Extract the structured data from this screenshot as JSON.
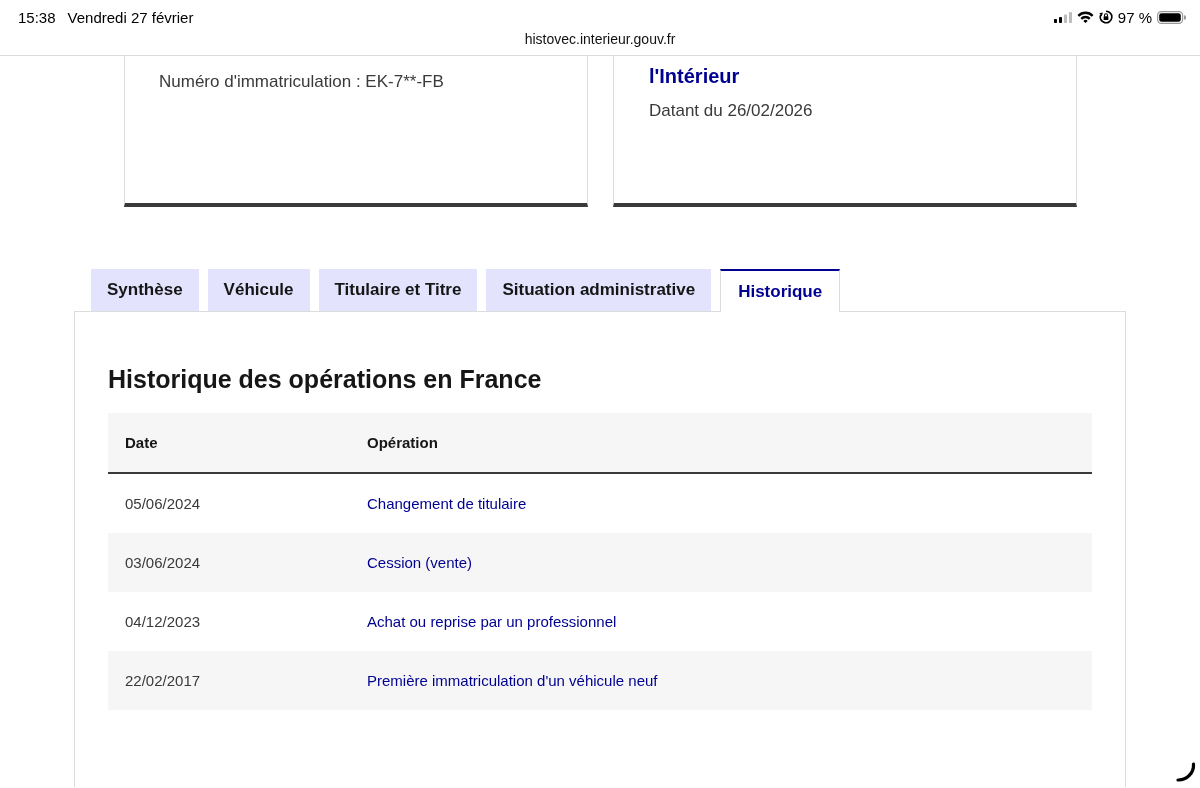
{
  "status_bar": {
    "time": "15:38",
    "date": "Vendredi 27 février",
    "battery": "97 %",
    "url": "histovec.interieur.gouv.fr"
  },
  "cards": [
    {
      "lines": [
        {
          "kind": "text",
          "text": "Numéro d'immatriculation : EK-7**-FB"
        }
      ]
    },
    {
      "lines": [
        {
          "kind": "title",
          "text": "l'Intérieur"
        },
        {
          "kind": "text",
          "text": "Datant du 26/02/2026"
        }
      ]
    }
  ],
  "tabs": [
    {
      "label": "Synthèse",
      "selected": false
    },
    {
      "label": "Véhicule",
      "selected": false
    },
    {
      "label": "Titulaire et Titre",
      "selected": false
    },
    {
      "label": "Situation administrative",
      "selected": false
    },
    {
      "label": "Historique",
      "selected": true
    }
  ],
  "panel": {
    "heading": "Historique des opérations en France",
    "table": {
      "columns": [
        "Date",
        "Opération"
      ],
      "rows": [
        {
          "date": "05/06/2024",
          "operation": "Changement de titulaire"
        },
        {
          "date": "03/06/2024",
          "operation": "Cession (vente)"
        },
        {
          "date": "04/12/2023",
          "operation": "Achat ou reprise par un professionnel"
        },
        {
          "date": "22/02/2017",
          "operation": "Première immatriculation d'un véhicule neuf"
        }
      ]
    }
  }
}
